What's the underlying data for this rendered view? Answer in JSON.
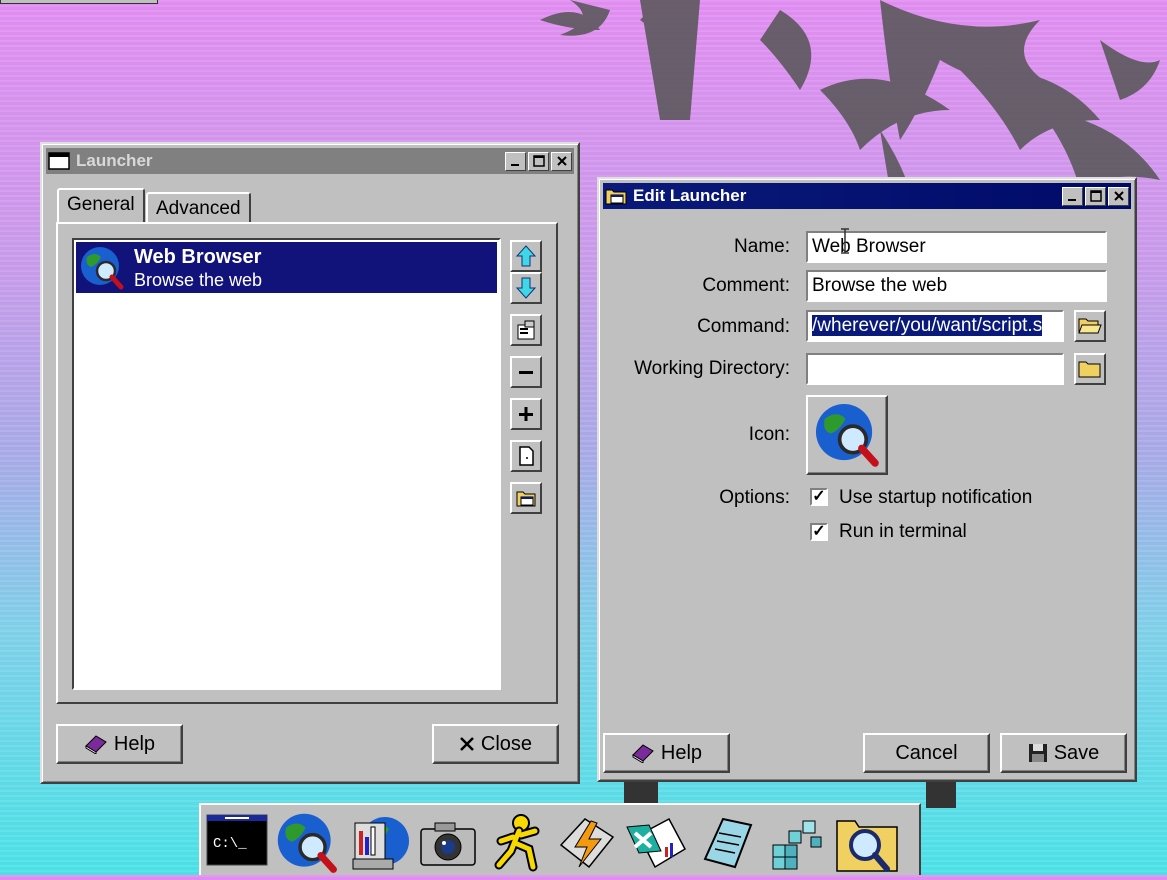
{
  "colors": {
    "title_active": "#0a1a7a",
    "title_inactive": "#808080",
    "selection": "#12137a",
    "window_face": "#c0c0c0",
    "desktop_top": "#e08cf0",
    "desktop_bottom": "#49e1e6"
  },
  "launcher": {
    "title": "Launcher",
    "title_icon": "window-icon",
    "tabs": [
      {
        "label": "General",
        "selected": true
      },
      {
        "label": "Advanced",
        "selected": false
      }
    ],
    "items": [
      {
        "title": "Web Browser",
        "subtitle": "Browse the web",
        "icon": "globe-magnifier-icon",
        "selected": true
      }
    ],
    "side_buttons": [
      "move-up-icon",
      "move-down-icon",
      "properties-icon",
      "remove-icon",
      "add-icon",
      "new-item-icon",
      "folder-launcher-icon"
    ],
    "help_label": "Help",
    "close_label": "Close"
  },
  "edit_launcher": {
    "title": "Edit Launcher",
    "title_icon": "folder-launcher-icon",
    "name_label": "Name:",
    "name_value": "Web Browser",
    "comment_label": "Comment:",
    "comment_value": "Browse the web",
    "command_label": "Command:",
    "command_value": "/wherever/you/want/script.s",
    "workdir_label": "Working Directory:",
    "workdir_value": "",
    "icon_label": "Icon:",
    "icon_name": "globe-magnifier-icon",
    "options_label": "Options:",
    "options": [
      {
        "label": "Use startup notification",
        "checked": true
      },
      {
        "label": "Run in terminal",
        "checked": true
      }
    ],
    "help_label": "Help",
    "cancel_label": "Cancel",
    "save_label": "Save"
  },
  "dock": {
    "terminal_text": "C:\\_",
    "items": [
      "terminal-icon",
      "web-browser-icon",
      "file-manager-icon",
      "camera-icon",
      "runner-icon",
      "winamp-icon",
      "excel-icon",
      "notepad-icon",
      "blocks-icon",
      "folder-search-icon"
    ]
  }
}
